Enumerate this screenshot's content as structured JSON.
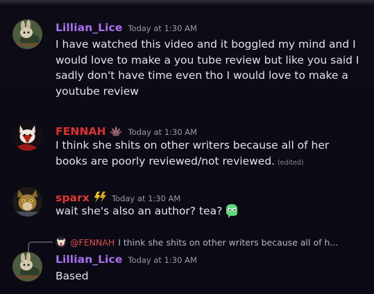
{
  "messages": [
    {
      "username": "Lillian_Lice",
      "name_color": "#a970f0",
      "timestamp": "Today at 1:30 AM",
      "avatar_icon": "bunny-avatar-icon",
      "lines": [
        "I have watched this video and it boggled my mind and I",
        "would love to make a you tube review but like you said I",
        "sadly don't have time even tho I would love to make a",
        "youtube review"
      ]
    },
    {
      "username": "FENNAH",
      "name_color": "#e03030",
      "badge_icon": "lotus-icon",
      "timestamp": "Today at 1:30 AM",
      "avatar_icon": "fox-avatar-icon",
      "lines": [
        "I think she shits on other writers because all of her",
        "books are poorly reviewed/not reviewed."
      ],
      "edited_label": "(edited)"
    },
    {
      "username": "sparx",
      "name_color": "#e0392e",
      "badge_icon": "lightning-bolts-icon",
      "timestamp": "Today at 1:30 AM",
      "avatar_icon": "cat-avatar-icon",
      "text": "wait she's also an author? tea?",
      "emoji_icon": "green-ghost-emoji-icon"
    },
    {
      "username": "Lillian_Lice",
      "name_color": "#a970f0",
      "timestamp": "Today at 1:30 AM",
      "avatar_icon": "bunny-avatar-icon",
      "text": "Based",
      "reply": {
        "mention": "@FENNAH",
        "mention_color": "#e24e4e",
        "preview": "I think she shits on other writers because all of h..."
      }
    }
  ]
}
